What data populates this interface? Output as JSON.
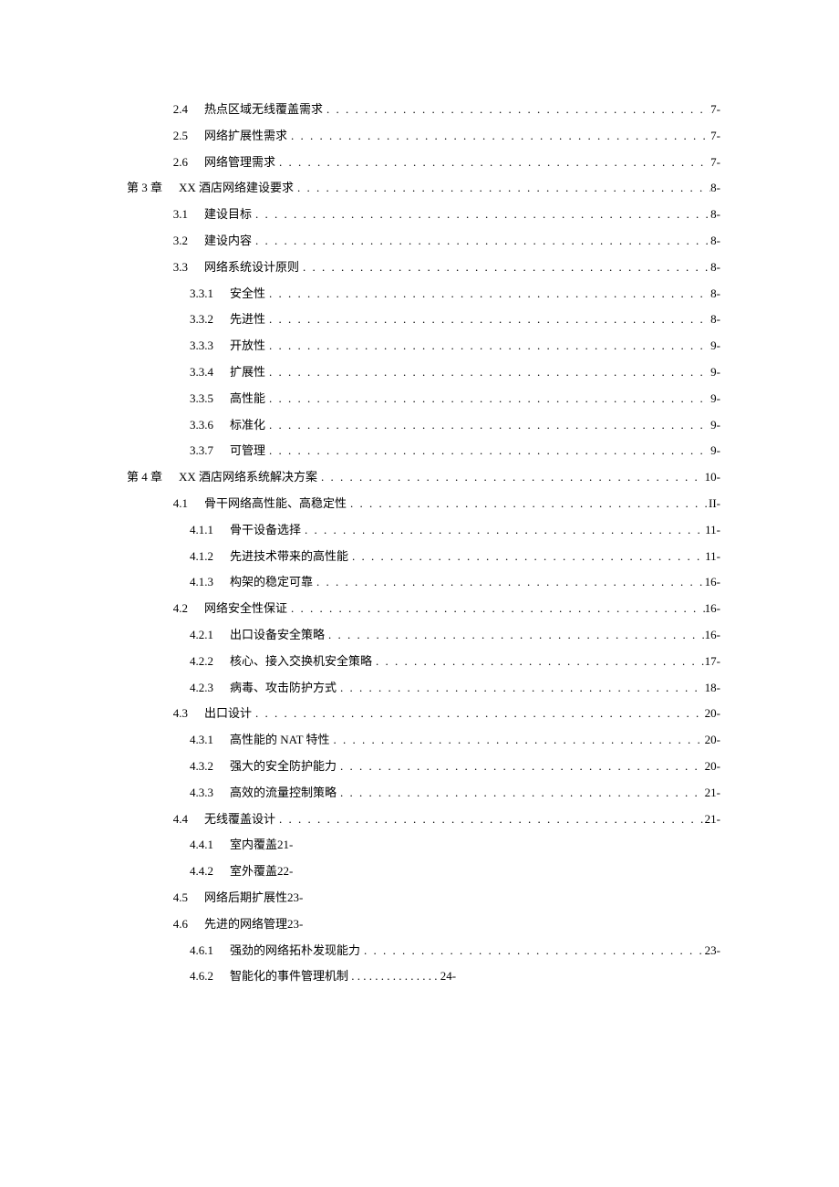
{
  "entries": [
    {
      "lvl": 2,
      "num": "2.4",
      "title": "热点区域无线覆盖需求",
      "page": "7-",
      "dots": true
    },
    {
      "lvl": 2,
      "num": "2.5",
      "title": "网络扩展性需求",
      "page": "7-",
      "dots": true
    },
    {
      "lvl": 2,
      "num": "2.6",
      "title": "网络管理需求",
      "page": "7-",
      "dots": true
    },
    {
      "lvl": 1,
      "num": "第 3 章",
      "title": "XX 酒店网络建设要求",
      "page": "8-",
      "dots": true
    },
    {
      "lvl": 2,
      "num": "3.1",
      "title": "建设目标",
      "page": "8-",
      "dots": true
    },
    {
      "lvl": 2,
      "num": "3.2",
      "title": "建设内容",
      "page": "8-",
      "dots": true
    },
    {
      "lvl": 2,
      "num": "3.3",
      "title": "网络系统设计原则",
      "page": "8-",
      "dots": true
    },
    {
      "lvl": 3,
      "num": "3.3.1",
      "title": "安全性",
      "page": "8-",
      "dots": true
    },
    {
      "lvl": 3,
      "num": "3.3.2",
      "title": "先进性",
      "page": "8-",
      "dots": true
    },
    {
      "lvl": 3,
      "num": "3.3.3",
      "title": "开放性",
      "page": "9-",
      "dots": true
    },
    {
      "lvl": 3,
      "num": "3.3.4",
      "title": "扩展性",
      "page": "9-",
      "dots": true
    },
    {
      "lvl": 3,
      "num": "3.3.5",
      "title": "高性能",
      "page": "9-",
      "dots": true
    },
    {
      "lvl": 3,
      "num": "3.3.6",
      "title": "标准化",
      "page": "9-",
      "dots": true
    },
    {
      "lvl": 3,
      "num": "3.3.7",
      "title": "可管理",
      "page": "9-",
      "dots": true
    },
    {
      "lvl": 1,
      "num": "第 4 章",
      "title": "XX 酒店网络系统解决方案",
      "page": "10-",
      "dots": true
    },
    {
      "lvl": 2,
      "num": "4.1",
      "title": "骨干网络高性能、高稳定性",
      "page": "II-",
      "dots": true
    },
    {
      "lvl": 3,
      "num": "4.1.1",
      "title": "骨干设备选择",
      "page": "11-",
      "dots": true
    },
    {
      "lvl": 3,
      "num": "4.1.2",
      "title": "先进技术带来的高性能",
      "page": "11-",
      "dots": true
    },
    {
      "lvl": 3,
      "num": "4.1.3",
      "title": "构架的稳定可靠",
      "page": "16-",
      "dots": true
    },
    {
      "lvl": 2,
      "num": "4.2",
      "title": "网络安全性保证",
      "page": "16-",
      "dots": true
    },
    {
      "lvl": 3,
      "num": "4.2.1",
      "title": "出口设备安全策略",
      "page": "16-",
      "dots": true
    },
    {
      "lvl": 3,
      "num": "4.2.2",
      "title": "核心、接入交换机安全策略",
      "page": "17-",
      "dots": true
    },
    {
      "lvl": 3,
      "num": "4.2.3",
      "title": "病毒、攻击防护方式",
      "page": "18-",
      "dots": true
    },
    {
      "lvl": 2,
      "num": "4.3",
      "title": "出口设计",
      "page": "20-",
      "dots": true
    },
    {
      "lvl": 3,
      "num": "4.3.1",
      "title": "高性能的 NAT 特性",
      "page": "20-",
      "dots": true
    },
    {
      "lvl": 3,
      "num": "4.3.2",
      "title": "强大的安全防护能力",
      "page": "20-",
      "dots": true
    },
    {
      "lvl": 3,
      "num": "4.3.3",
      "title": "高效的流量控制策略",
      "page": "21-",
      "dots": true
    },
    {
      "lvl": 2,
      "num": "4.4",
      "title": "无线覆盖设计",
      "page": "21-",
      "dots": true
    },
    {
      "lvl": 3,
      "num": "4.4.1",
      "title": "室内覆盖21-",
      "page": "",
      "dots": false
    },
    {
      "lvl": 3,
      "num": "4.4.2",
      "title": "室外覆盖22-",
      "page": "",
      "dots": false
    },
    {
      "lvl": 2,
      "num": "4.5",
      "title": "网络后期扩展性23-",
      "page": "",
      "dots": false
    },
    {
      "lvl": 2,
      "num": "4.6",
      "title": "先进的网络管理23-",
      "page": "",
      "dots": false
    },
    {
      "lvl": 3,
      "num": "4.6.1",
      "title": "强劲的网络拓朴发现能力",
      "page": "23-",
      "dots": true
    },
    {
      "lvl": 3,
      "num": "4.6.2",
      "title": "智能化的事件管理机制 . . . . . . . . . . . . . . . 24-",
      "page": "",
      "dots": false
    }
  ]
}
